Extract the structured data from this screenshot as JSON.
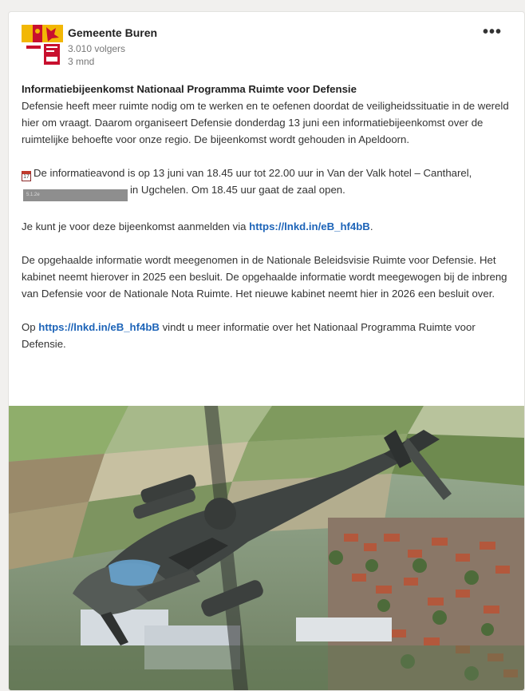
{
  "post": {
    "org_name": "Gemeente Buren",
    "followers": "3.010 volgers",
    "age": "3 mnd",
    "more_label": "•••",
    "title": "Informatiebijeenkomst Nationaal Programma Ruimte voor Defensie",
    "p1": "Defensie heeft meer ruimte nodig om te werken en te oefenen doordat de veiligheidssituatie in de wereld hier om vraagt. Daarom organiseert Defensie donderdag 13 juni een informatiebijeenkomst over de ruimtelijke behoefte voor onze regio. De bijeenkomst wordt gehouden in Apeldoorn.",
    "calendar_icon_text": "17",
    "p2_before": "De informatieavond is op 13 juni van 18.45 uur tot 22.00  uur in Van der Valk hotel – Cantharel,",
    "redacted_text": "5.1.2e",
    "p2_after": "in Ugchelen. Om 18.45 uur gaat de zaal open.",
    "p3_before": "Je kunt je voor deze bijeenkomst aanmelden via ",
    "link1": "https://lnkd.in/eB_hf4bB",
    "p3_after": ".",
    "p4": "De opgehaalde informatie wordt meegenomen in de Nationale Beleidsvisie Ruimte voor Defensie. Het kabinet neemt hierover in 2025 een besluit. De opgehaalde informatie wordt meegewogen bij de inbreng van Defensie voor de Nationale Nota Ruimte. Het nieuwe kabinet neemt hier in 2026 een besluit over.",
    "p5_before": "Op ",
    "link2": "https://lnkd.in/eB_hf4bB",
    "p5_after": " vindt u meer informatie over het Nationaal Programma Ruimte voor Defensie."
  },
  "colors": {
    "link": "#1d64b8",
    "logo_red": "#c8102e",
    "logo_gold": "#f2b705"
  },
  "image": {
    "subject": "apache-helicopter-over-town-photo"
  }
}
